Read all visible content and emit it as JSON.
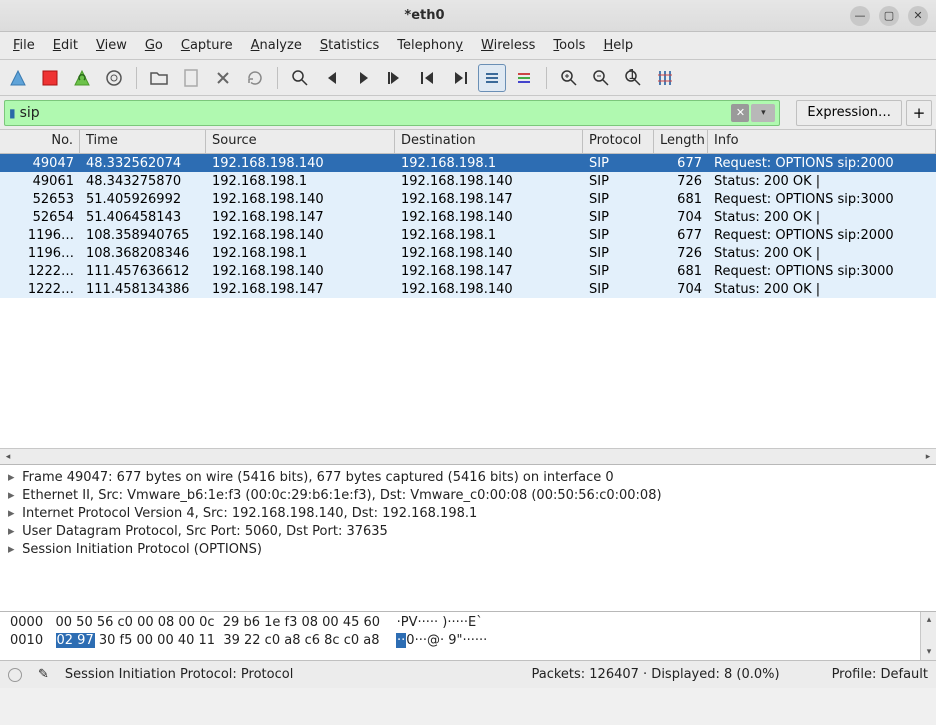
{
  "window": {
    "title": "*eth0"
  },
  "menu": [
    "File",
    "Edit",
    "View",
    "Go",
    "Capture",
    "Analyze",
    "Statistics",
    "Telephony",
    "Wireless",
    "Tools",
    "Help"
  ],
  "filter": {
    "value": "sip",
    "expression_label": "Expression…"
  },
  "columns": {
    "no": "No.",
    "time": "Time",
    "source": "Source",
    "destination": "Destination",
    "protocol": "Protocol",
    "length": "Length",
    "info": "Info"
  },
  "packets": [
    {
      "no": "49047",
      "time": "48.332562074",
      "src": "192.168.198.140",
      "dst": "192.168.198.1",
      "prot": "SIP",
      "len": "677",
      "info": "Request: OPTIONS sip:2000",
      "selected": true
    },
    {
      "no": "49061",
      "time": "48.343275870",
      "src": "192.168.198.1",
      "dst": "192.168.198.140",
      "prot": "SIP",
      "len": "726",
      "info": "Status: 200 OK |"
    },
    {
      "no": "52653",
      "time": "51.405926992",
      "src": "192.168.198.140",
      "dst": "192.168.198.147",
      "prot": "SIP",
      "len": "681",
      "info": "Request: OPTIONS sip:3000"
    },
    {
      "no": "52654",
      "time": "51.406458143",
      "src": "192.168.198.147",
      "dst": "192.168.198.140",
      "prot": "SIP",
      "len": "704",
      "info": "Status: 200 OK |"
    },
    {
      "no": "1196…",
      "time": "108.358940765",
      "src": "192.168.198.140",
      "dst": "192.168.198.1",
      "prot": "SIP",
      "len": "677",
      "info": "Request: OPTIONS sip:2000"
    },
    {
      "no": "1196…",
      "time": "108.368208346",
      "src": "192.168.198.1",
      "dst": "192.168.198.140",
      "prot": "SIP",
      "len": "726",
      "info": "Status: 200 OK |"
    },
    {
      "no": "1222…",
      "time": "111.457636612",
      "src": "192.168.198.140",
      "dst": "192.168.198.147",
      "prot": "SIP",
      "len": "681",
      "info": "Request: OPTIONS sip:3000"
    },
    {
      "no": "1222…",
      "time": "111.458134386",
      "src": "192.168.198.147",
      "dst": "192.168.198.140",
      "prot": "SIP",
      "len": "704",
      "info": "Status: 200 OK |"
    }
  ],
  "details": [
    "Frame 49047: 677 bytes on wire (5416 bits), 677 bytes captured (5416 bits) on interface 0",
    "Ethernet II, Src: Vmware_b6:1e:f3 (00:0c:29:b6:1e:f3), Dst: Vmware_c0:00:08 (00:50:56:c0:00:08)",
    "Internet Protocol Version 4, Src: 192.168.198.140, Dst: 192.168.198.1",
    "User Datagram Protocol, Src Port: 5060, Dst Port: 37635",
    "Session Initiation Protocol (OPTIONS)"
  ],
  "hex": {
    "l0_off": "0000",
    "l0_b": "00 50 56 c0 00 08 00 0c  29 b6 1e f3 08 00 45 60",
    "l0_a": "·PV····· )·····E`",
    "l1_off": "0010",
    "l1_sel": "02 97",
    "l1_rest": " 30 f5 00 00 40 11  39 22 c0 a8 c6 8c c0 a8",
    "l1_a_sel": "··",
    "l1_a_rest": "0···@· 9\"······"
  },
  "status": {
    "left": "Session Initiation Protocol: Protocol",
    "mid": "Packets: 126407 · Displayed: 8 (0.0%)",
    "right": "Profile: Default"
  }
}
